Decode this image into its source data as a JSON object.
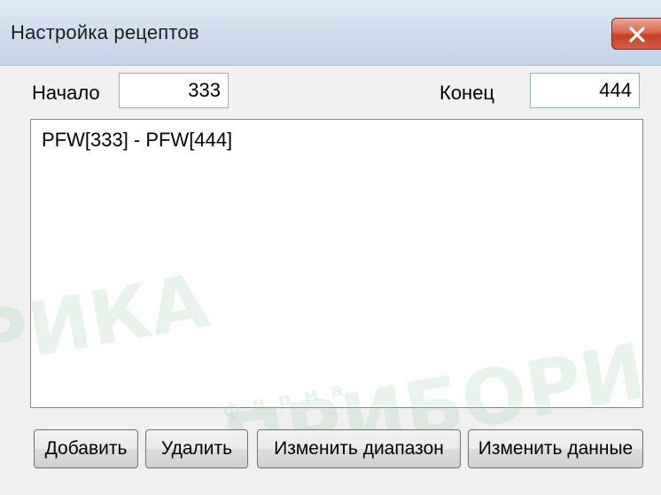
{
  "window": {
    "title": "Настройка рецептов",
    "close_icon": "close-x-icon"
  },
  "range": {
    "start_label": "Начало",
    "start_value": "333",
    "end_label": "Конец",
    "end_value": "444"
  },
  "recipe_list": {
    "items": [
      "PFW[333] - PFW[444]"
    ]
  },
  "buttons": {
    "add": "Добавить",
    "delete": "Удалить",
    "change_range": "Изменить диапазон",
    "change_data": "Изменить данные"
  },
  "watermark": {
    "line1": "РИКА",
    "line2": "ф и р м а",
    "line3": "ПРИБОРИ"
  },
  "colors": {
    "close_button": "#d9674f",
    "titlebar": "#cfdcec",
    "dialog_background": "#f0f0f0"
  }
}
